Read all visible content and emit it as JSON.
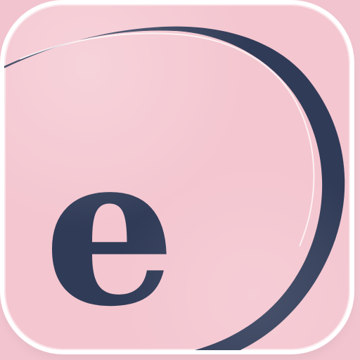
{
  "app_icon": {
    "letter": "e",
    "background_color": "#f4c6d0",
    "accent_color": "#303b57",
    "icon_name": "orbit-letter-e-icon"
  }
}
